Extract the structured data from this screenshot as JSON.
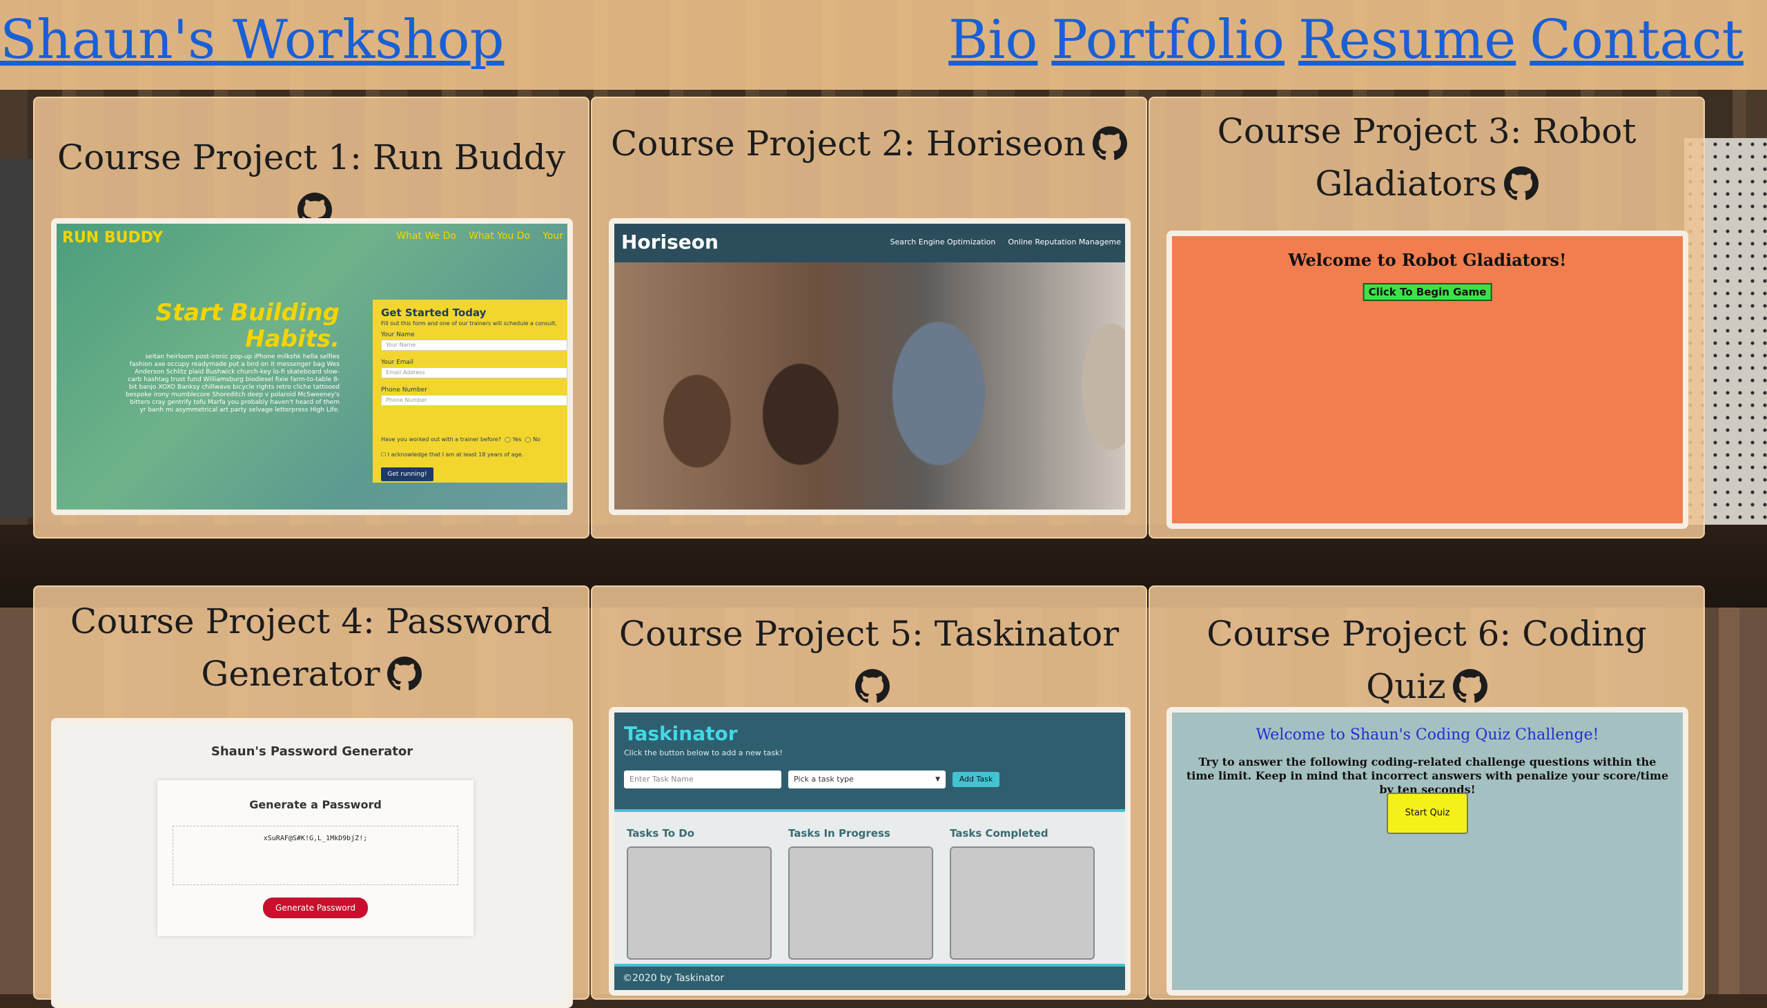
{
  "header": {
    "brand": "Shaun's Workshop",
    "nav": [
      "Bio",
      "Portfolio",
      "Resume",
      "Contact"
    ]
  },
  "colors": {
    "link": "#1a5fd6",
    "header_bg": "#f0c48c",
    "card_bg": "#eec492"
  },
  "projects": [
    {
      "title": "Course Project 1: Run Buddy",
      "icon": "github-icon",
      "shot": {
        "logo": "RUN BUDDY",
        "nav": [
          "What We Do",
          "What You Do",
          "Your"
        ],
        "headline": "Start Building Habits.",
        "lorem": "seitan heirloom post-ironic pop-up iPhone milkshk hella selfies fashion axe occupy readymade put a bird on it messenger bag Wes Anderson Schlitz plaid Bushwick church-key lo-fi skateboard slow-carb hashtag trust fund Williamsburg biodiesel fixie farm-to-table 8-bit banjo XOXO Banksy chillwave bicycle rights retro cliche tattooed bespoke irony mumblecore Shoreditch deep v polaroid McSweeney's bitters cray gentrify tofu Marfa you probably haven't heard of them yr banh mi asymmetrical art party selvage letterpress High Life.",
        "form_title": "Get Started Today",
        "form_sub": "Fill out this form and one of our trainers will schedule a consult.",
        "name_label": "Your Name",
        "name_placeholder": "Your Name",
        "email_label": "Your Email",
        "email_placeholder": "Email Address",
        "phone_label": "Phone Number",
        "phone_placeholder": "Phone Number",
        "radio_q": "Have you worked out with a trainer before?",
        "radio_yes": "Yes",
        "radio_no": "No",
        "ack": "I acknowledge that I am at least 18 years of age.",
        "submit": "Get running!"
      }
    },
    {
      "title": "Course Project 2: Horiseon",
      "icon": "github-icon",
      "shot": {
        "logo": "Horiseon",
        "nav": [
          "Search Engine Optimization",
          "Online Reputation Manageme"
        ]
      }
    },
    {
      "title": "Course Project 3: Robot Gladiators",
      "icon": "github-icon",
      "shot": {
        "welcome": "Welcome to Robot Gladiators!",
        "button": "Click To Begin Game"
      }
    },
    {
      "title": "Course Project 4: Password Generator",
      "icon": "github-icon",
      "shot": {
        "page_title": "Shaun's Password Generator",
        "card_title": "Generate a Password",
        "password": "xSuRAF@S#K!G,L_1MkD9bjZ!;",
        "button": "Generate Password"
      }
    },
    {
      "title": "Course Project 5: Taskinator",
      "icon": "github-icon",
      "shot": {
        "logo": "Taskinator",
        "subtitle": "Click the button below to add a new task!",
        "task_placeholder": "Enter Task Name",
        "type_select": "Pick a task type",
        "add": "Add Task",
        "columns": [
          "Tasks To Do",
          "Tasks In Progress",
          "Tasks Completed"
        ],
        "footer": "©2020 by Taskinator"
      }
    },
    {
      "title": "Course Project 6: Coding Quiz",
      "icon": "github-icon",
      "shot": {
        "welcome": "Welcome to Shaun's Coding Quiz Challenge!",
        "desc": "Try to answer the following coding-related challenge questions within the time limit. Keep in mind that incorrect answers with penalize your score/time by ten seconds!",
        "button": "Start Quiz"
      }
    }
  ]
}
